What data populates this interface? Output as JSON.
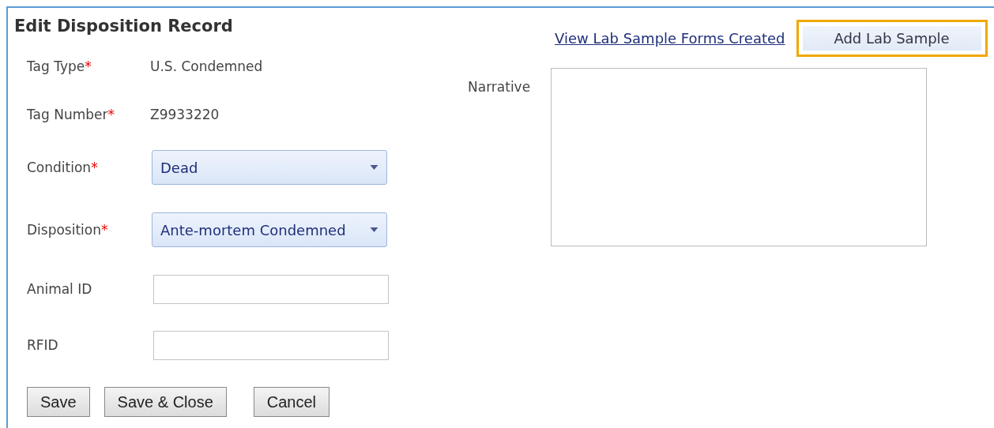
{
  "title": "Edit Disposition Record",
  "fields": [
    {
      "kind": "static",
      "label": "Tag Type",
      "required_mark": "*",
      "value": "U.S. Condemned"
    },
    {
      "kind": "static",
      "label": "Tag Number",
      "required_mark": "*",
      "value": "Z9933220"
    },
    {
      "kind": "select",
      "label": "Condition",
      "required_mark": "*",
      "value": "Dead"
    },
    {
      "kind": "select",
      "label": "Disposition",
      "required_mark": "*",
      "value": "Ante-mortem Condemned"
    },
    {
      "kind": "text",
      "label": "Animal ID"
    },
    {
      "kind": "text",
      "label": "RFID"
    }
  ],
  "buttons": [
    "Save",
    "Save & Close",
    "Cancel"
  ],
  "link": "View Lab Sample Forms Created",
  "add_button": {
    "label": "Add Lab Sample",
    "focused": true
  },
  "narrative": {
    "label": "Narrative"
  }
}
